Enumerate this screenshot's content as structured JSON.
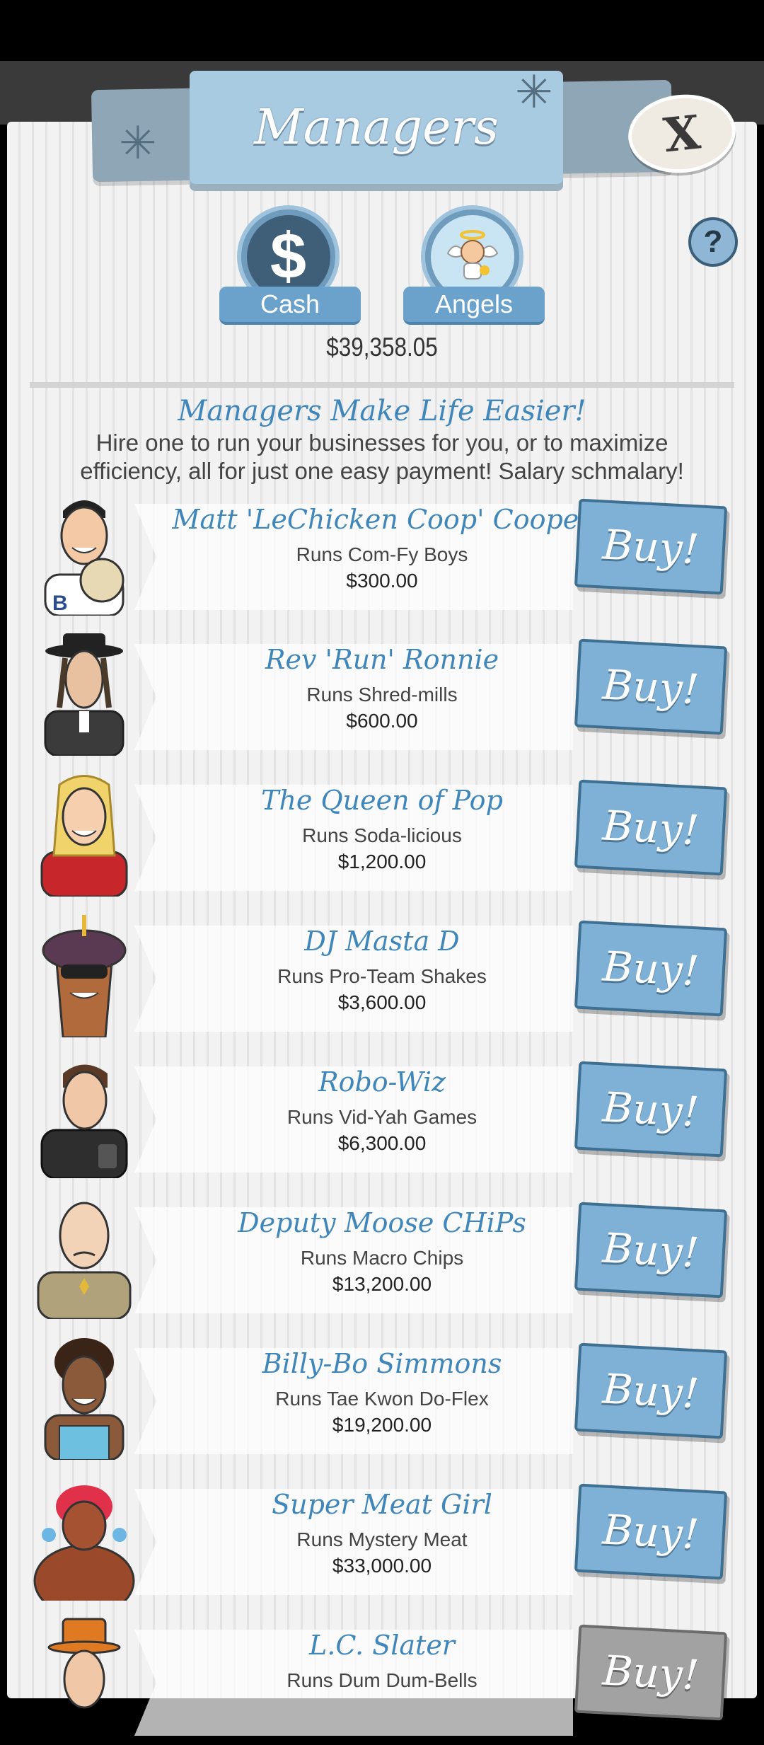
{
  "header": {
    "title": "Managers",
    "close_label": "X",
    "help_label": "?"
  },
  "currency": {
    "cash_label": "Cash",
    "cash_icon": "dollar-sign-icon",
    "angels_label": "Angels",
    "angels_icon": "angel-icon",
    "balance": "$39,358.05"
  },
  "intro": {
    "title": "Managers Make Life Easier!",
    "text": "Hire one to run your businesses for you, or to maximize efficiency, all for just one easy payment! Salary schmalary!"
  },
  "managers": [
    {
      "name": "Matt 'LeChicken Coop' Cooper",
      "runs": "Runs Com-Fy Boys",
      "price": "$300.00",
      "buy": "Buy!",
      "enabled": true
    },
    {
      "name": "Rev 'Run' Ronnie",
      "runs": "Runs Shred-mills",
      "price": "$600.00",
      "buy": "Buy!",
      "enabled": true
    },
    {
      "name": "The Queen of Pop",
      "runs": "Runs Soda-licious",
      "price": "$1,200.00",
      "buy": "Buy!",
      "enabled": true
    },
    {
      "name": "DJ Masta D",
      "runs": "Runs Pro-Team Shakes",
      "price": "$3,600.00",
      "buy": "Buy!",
      "enabled": true
    },
    {
      "name": "Robo-Wiz",
      "runs": "Runs Vid-Yah Games",
      "price": "$6,300.00",
      "buy": "Buy!",
      "enabled": true
    },
    {
      "name": "Deputy Moose CHiPs",
      "runs": "Runs Macro Chips",
      "price": "$13,200.00",
      "buy": "Buy!",
      "enabled": true
    },
    {
      "name": "Billy-Bo Simmons",
      "runs": "Runs Tae Kwon Do-Flex",
      "price": "$19,200.00",
      "buy": "Buy!",
      "enabled": true
    },
    {
      "name": "Super Meat Girl",
      "runs": "Runs Mystery Meat",
      "price": "$33,000.00",
      "buy": "Buy!",
      "enabled": true
    },
    {
      "name": "L.C. Slater",
      "runs": "Runs Dum Dum-Bells",
      "price": "",
      "buy": "Buy!",
      "enabled": false
    }
  ],
  "colors": {
    "accent_blue": "#3f86bb",
    "buy_button": "#7fb1d6",
    "buy_disabled": "#a2a2a2"
  }
}
